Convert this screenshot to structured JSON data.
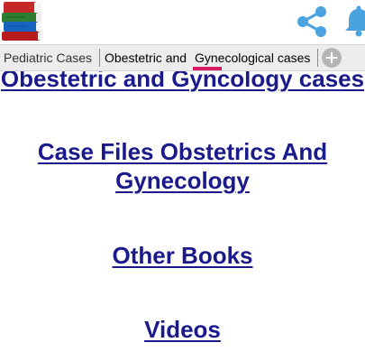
{
  "tabs": [
    {
      "label": "Pediatric Cases",
      "active": false
    },
    {
      "label": "Obestetric and",
      "active": true
    },
    {
      "label": "Gynecological cases",
      "active": true
    }
  ],
  "links": [
    {
      "label": "Obestetric and Gyncology cases"
    },
    {
      "label": "Case Files Obstetrics And Gynecology"
    },
    {
      "label": "Other Books"
    },
    {
      "label": "Videos"
    }
  ],
  "icons": {
    "app": "books-stack-icon",
    "share": "share-icon",
    "notifications": "bell-icon",
    "add_tab": "add-tab-icon"
  },
  "colors": {
    "link": "#1a1a8c",
    "tab_indicator": "#d81b60",
    "tab_bar_bg": "#ececec",
    "icon_blue": "#4aa3df"
  }
}
